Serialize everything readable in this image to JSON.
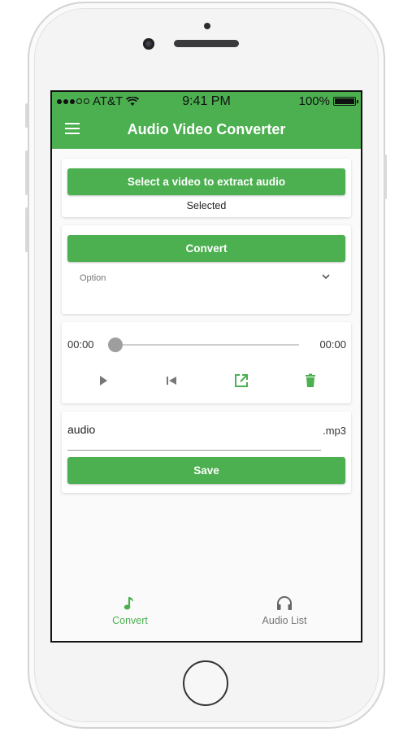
{
  "status": {
    "carrier": "AT&T",
    "time": "9:41 PM",
    "battery": "100%"
  },
  "app": {
    "title": "Audio Video Converter"
  },
  "select_card": {
    "button_label": "Select a video to extract audio",
    "selected_text": "Selected"
  },
  "convert_card": {
    "button_label": "Convert",
    "option_placeholder": "Option"
  },
  "player": {
    "current_time": "00:00",
    "total_time": "00:00",
    "progress": 0
  },
  "save_card": {
    "filename": "audio",
    "extension": ".mp3",
    "button_label": "Save"
  },
  "tabs": [
    {
      "label": "Convert",
      "icon": "music-note-icon",
      "active": true
    },
    {
      "label": "Audio List",
      "icon": "headphones-icon",
      "active": false
    }
  ],
  "colors": {
    "accent": "#4caf50",
    "inactive": "#757575",
    "delete": "#4caf50"
  }
}
